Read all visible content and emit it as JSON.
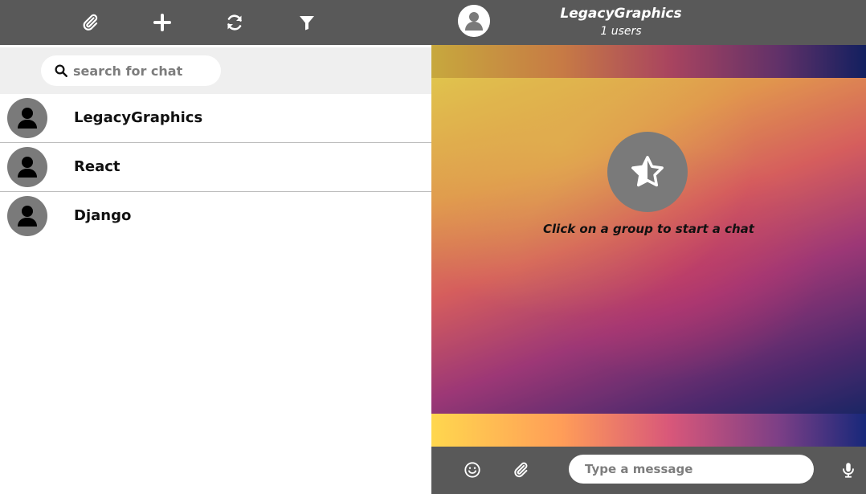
{
  "left_toolbar": {
    "buttons": [
      {
        "icon": "paperclip-icon"
      },
      {
        "icon": "plus-icon"
      },
      {
        "icon": "refresh-icon"
      },
      {
        "icon": "filter-icon"
      }
    ]
  },
  "search": {
    "placeholder": "search for chat",
    "value": ""
  },
  "chats": [
    {
      "name": "LegacyGraphics"
    },
    {
      "name": "React"
    },
    {
      "name": "Django"
    }
  ],
  "chat_header": {
    "title": "LegacyGraphics",
    "subtitle": "1 users"
  },
  "welcome": {
    "message": "Click on a group to start a chat",
    "icon": "star-half-icon"
  },
  "composer": {
    "placeholder": "Type a message",
    "value": ""
  },
  "colors": {
    "toolbar_bg": "#595959",
    "search_bg": "#efefef",
    "avatar_bg": "#7a7a7a"
  }
}
